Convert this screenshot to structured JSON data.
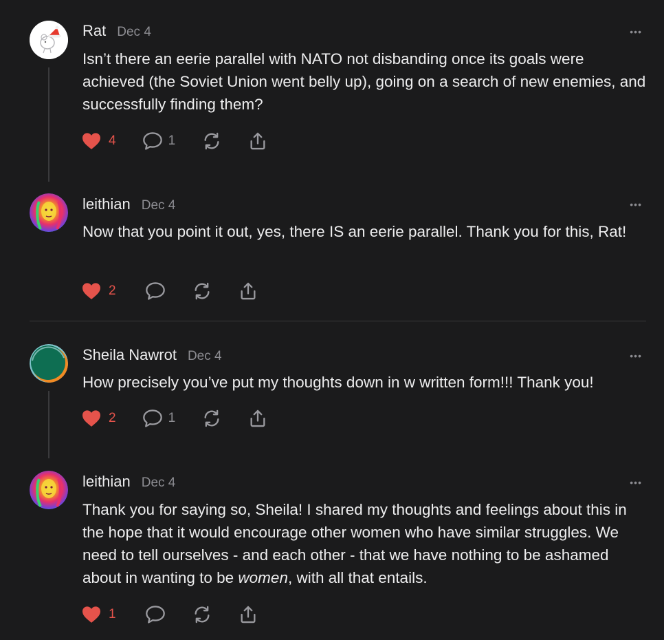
{
  "colors": {
    "background": "#1b1b1c",
    "like": "#e5534b",
    "muted": "#8d8d92",
    "text": "#ededee"
  },
  "comments": [
    {
      "author": "Rat",
      "date": "Dec 4",
      "avatar_icon": "rat-santa-hat-avatar",
      "text": "Isn’t there an eerie parallel with NATO not disbanding once its goals were achieved (the Soviet Union went belly up), going on a search of new enemies, and successfully finding them?",
      "likes": "4",
      "replies": "1"
    },
    {
      "author": "leithian",
      "date": "Dec 4",
      "avatar_icon": "rainbow-portrait-avatar",
      "text": "Now that you point it out, yes, there IS an eerie parallel. Thank you for this, Rat!",
      "likes": "2",
      "replies": ""
    },
    {
      "author": "Sheila Nawrot",
      "date": "Dec 4",
      "avatar_icon": "green-orange-circle-avatar",
      "text": "How precisely you’ve put my thoughts down in w written form!!! Thank you!",
      "likes": "2",
      "replies": "1"
    },
    {
      "author": "leithian",
      "date": "Dec 4",
      "avatar_icon": "rainbow-portrait-avatar",
      "text_before": "Thank you for saying so, Sheila! I shared my thoughts and feelings about this in the hope that it would encourage other women who have similar struggles. We need to tell ourselves - and each other - that we have nothing to be ashamed about in wanting to be ",
      "text_emphasis": "women",
      "text_after": ", with all that entails.",
      "likes": "1",
      "replies": ""
    }
  ],
  "more_label": "•••"
}
